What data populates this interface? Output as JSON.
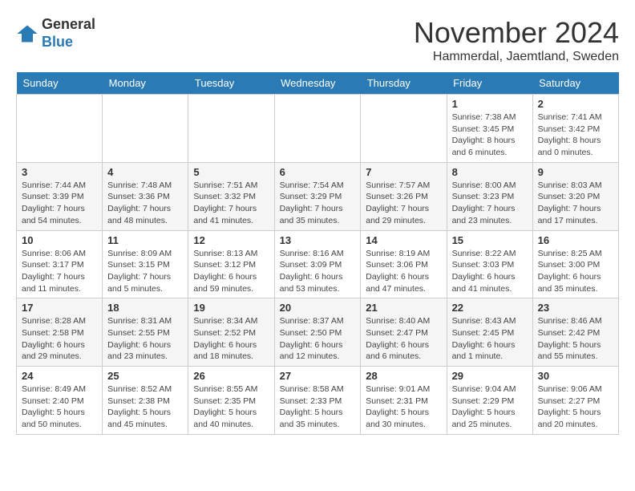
{
  "logo": {
    "general": "General",
    "blue": "Blue"
  },
  "title": {
    "month": "November 2024",
    "location": "Hammerdal, Jaemtland, Sweden"
  },
  "weekdays": [
    "Sunday",
    "Monday",
    "Tuesday",
    "Wednesday",
    "Thursday",
    "Friday",
    "Saturday"
  ],
  "weeks": [
    [
      {
        "day": "",
        "info": ""
      },
      {
        "day": "",
        "info": ""
      },
      {
        "day": "",
        "info": ""
      },
      {
        "day": "",
        "info": ""
      },
      {
        "day": "",
        "info": ""
      },
      {
        "day": "1",
        "info": "Sunrise: 7:38 AM\nSunset: 3:45 PM\nDaylight: 8 hours\nand 6 minutes."
      },
      {
        "day": "2",
        "info": "Sunrise: 7:41 AM\nSunset: 3:42 PM\nDaylight: 8 hours\nand 0 minutes."
      }
    ],
    [
      {
        "day": "3",
        "info": "Sunrise: 7:44 AM\nSunset: 3:39 PM\nDaylight: 7 hours\nand 54 minutes."
      },
      {
        "day": "4",
        "info": "Sunrise: 7:48 AM\nSunset: 3:36 PM\nDaylight: 7 hours\nand 48 minutes."
      },
      {
        "day": "5",
        "info": "Sunrise: 7:51 AM\nSunset: 3:32 PM\nDaylight: 7 hours\nand 41 minutes."
      },
      {
        "day": "6",
        "info": "Sunrise: 7:54 AM\nSunset: 3:29 PM\nDaylight: 7 hours\nand 35 minutes."
      },
      {
        "day": "7",
        "info": "Sunrise: 7:57 AM\nSunset: 3:26 PM\nDaylight: 7 hours\nand 29 minutes."
      },
      {
        "day": "8",
        "info": "Sunrise: 8:00 AM\nSunset: 3:23 PM\nDaylight: 7 hours\nand 23 minutes."
      },
      {
        "day": "9",
        "info": "Sunrise: 8:03 AM\nSunset: 3:20 PM\nDaylight: 7 hours\nand 17 minutes."
      }
    ],
    [
      {
        "day": "10",
        "info": "Sunrise: 8:06 AM\nSunset: 3:17 PM\nDaylight: 7 hours\nand 11 minutes."
      },
      {
        "day": "11",
        "info": "Sunrise: 8:09 AM\nSunset: 3:15 PM\nDaylight: 7 hours\nand 5 minutes."
      },
      {
        "day": "12",
        "info": "Sunrise: 8:13 AM\nSunset: 3:12 PM\nDaylight: 6 hours\nand 59 minutes."
      },
      {
        "day": "13",
        "info": "Sunrise: 8:16 AM\nSunset: 3:09 PM\nDaylight: 6 hours\nand 53 minutes."
      },
      {
        "day": "14",
        "info": "Sunrise: 8:19 AM\nSunset: 3:06 PM\nDaylight: 6 hours\nand 47 minutes."
      },
      {
        "day": "15",
        "info": "Sunrise: 8:22 AM\nSunset: 3:03 PM\nDaylight: 6 hours\nand 41 minutes."
      },
      {
        "day": "16",
        "info": "Sunrise: 8:25 AM\nSunset: 3:00 PM\nDaylight: 6 hours\nand 35 minutes."
      }
    ],
    [
      {
        "day": "17",
        "info": "Sunrise: 8:28 AM\nSunset: 2:58 PM\nDaylight: 6 hours\nand 29 minutes."
      },
      {
        "day": "18",
        "info": "Sunrise: 8:31 AM\nSunset: 2:55 PM\nDaylight: 6 hours\nand 23 minutes."
      },
      {
        "day": "19",
        "info": "Sunrise: 8:34 AM\nSunset: 2:52 PM\nDaylight: 6 hours\nand 18 minutes."
      },
      {
        "day": "20",
        "info": "Sunrise: 8:37 AM\nSunset: 2:50 PM\nDaylight: 6 hours\nand 12 minutes."
      },
      {
        "day": "21",
        "info": "Sunrise: 8:40 AM\nSunset: 2:47 PM\nDaylight: 6 hours\nand 6 minutes."
      },
      {
        "day": "22",
        "info": "Sunrise: 8:43 AM\nSunset: 2:45 PM\nDaylight: 6 hours\nand 1 minute."
      },
      {
        "day": "23",
        "info": "Sunrise: 8:46 AM\nSunset: 2:42 PM\nDaylight: 5 hours\nand 55 minutes."
      }
    ],
    [
      {
        "day": "24",
        "info": "Sunrise: 8:49 AM\nSunset: 2:40 PM\nDaylight: 5 hours\nand 50 minutes."
      },
      {
        "day": "25",
        "info": "Sunrise: 8:52 AM\nSunset: 2:38 PM\nDaylight: 5 hours\nand 45 minutes."
      },
      {
        "day": "26",
        "info": "Sunrise: 8:55 AM\nSunset: 2:35 PM\nDaylight: 5 hours\nand 40 minutes."
      },
      {
        "day": "27",
        "info": "Sunrise: 8:58 AM\nSunset: 2:33 PM\nDaylight: 5 hours\nand 35 minutes."
      },
      {
        "day": "28",
        "info": "Sunrise: 9:01 AM\nSunset: 2:31 PM\nDaylight: 5 hours\nand 30 minutes."
      },
      {
        "day": "29",
        "info": "Sunrise: 9:04 AM\nSunset: 2:29 PM\nDaylight: 5 hours\nand 25 minutes."
      },
      {
        "day": "30",
        "info": "Sunrise: 9:06 AM\nSunset: 2:27 PM\nDaylight: 5 hours\nand 20 minutes."
      }
    ]
  ]
}
